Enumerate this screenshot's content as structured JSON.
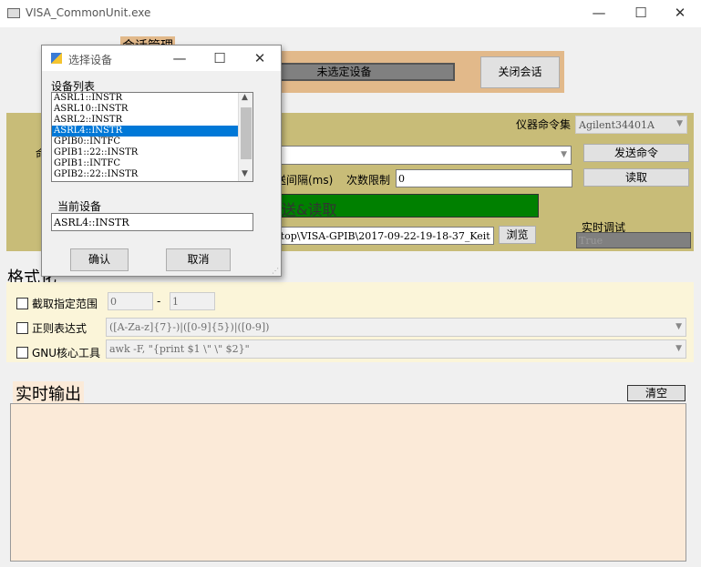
{
  "window": {
    "title": "VISA_CommonUnit.exe",
    "minimize": "—",
    "maximize": "☐",
    "close": "✕"
  },
  "session": {
    "group_label": "会话管理",
    "device_display": "未选定设备",
    "close_session_label": "关闭会话"
  },
  "command": {
    "instrument_set_label": "仪器命令集",
    "instrument_set_value": "Agilent34401A",
    "left_cut_label": "命",
    "send_command_label": "发送命令",
    "read_label": "读取",
    "send_interval_label": "送间隔(ms)",
    "count_limit_label": "次数限制",
    "count_limit_value": "0",
    "send_read_label": "送&读取",
    "path_value": "ktop\\VISA-GPIB\\2017-09-22-19-18-37_Keit",
    "browse_label": "浏览",
    "realtime_debug_label": "实时调试",
    "realtime_debug_value": "True"
  },
  "format": {
    "heading": "格式化",
    "range_label": "截取指定范围",
    "range_start": "0",
    "range_sep": "-",
    "range_end": "1",
    "regex_label": "正则表达式",
    "regex_value": "([A-Za-z]{7}-)|([0-9]{5})|([0-9])",
    "gnu_label": "GNU核心工具",
    "gnu_value": "awk -F, \"{print $1 \\\"  \\\" $2}\""
  },
  "output": {
    "heading": "实时输出",
    "clear_label": "清空"
  },
  "dialog": {
    "title": "选择设备",
    "minimize": "—",
    "maximize": "☐",
    "close": "✕",
    "list_label": "设备列表",
    "devices": [
      "ASRL1::INSTR",
      "ASRL10::INSTR",
      "ASRL2::INSTR",
      "ASRL4::INSTR",
      "GPIB0::INTFC",
      "GPIB1::22::INSTR",
      "GPIB1::INTFC",
      "GPIB2::22::INSTR"
    ],
    "selected_index": 3,
    "current_label": "当前设备",
    "current_value": "ASRL4::INSTR",
    "ok_label": "确认",
    "cancel_label": "取消"
  },
  "colors": {
    "accent_green": "#008000",
    "selection_blue": "#0078d7",
    "panel_olive": "#c8bc78",
    "session_peach": "#e2b98a",
    "output_bg": "#fbead8"
  }
}
